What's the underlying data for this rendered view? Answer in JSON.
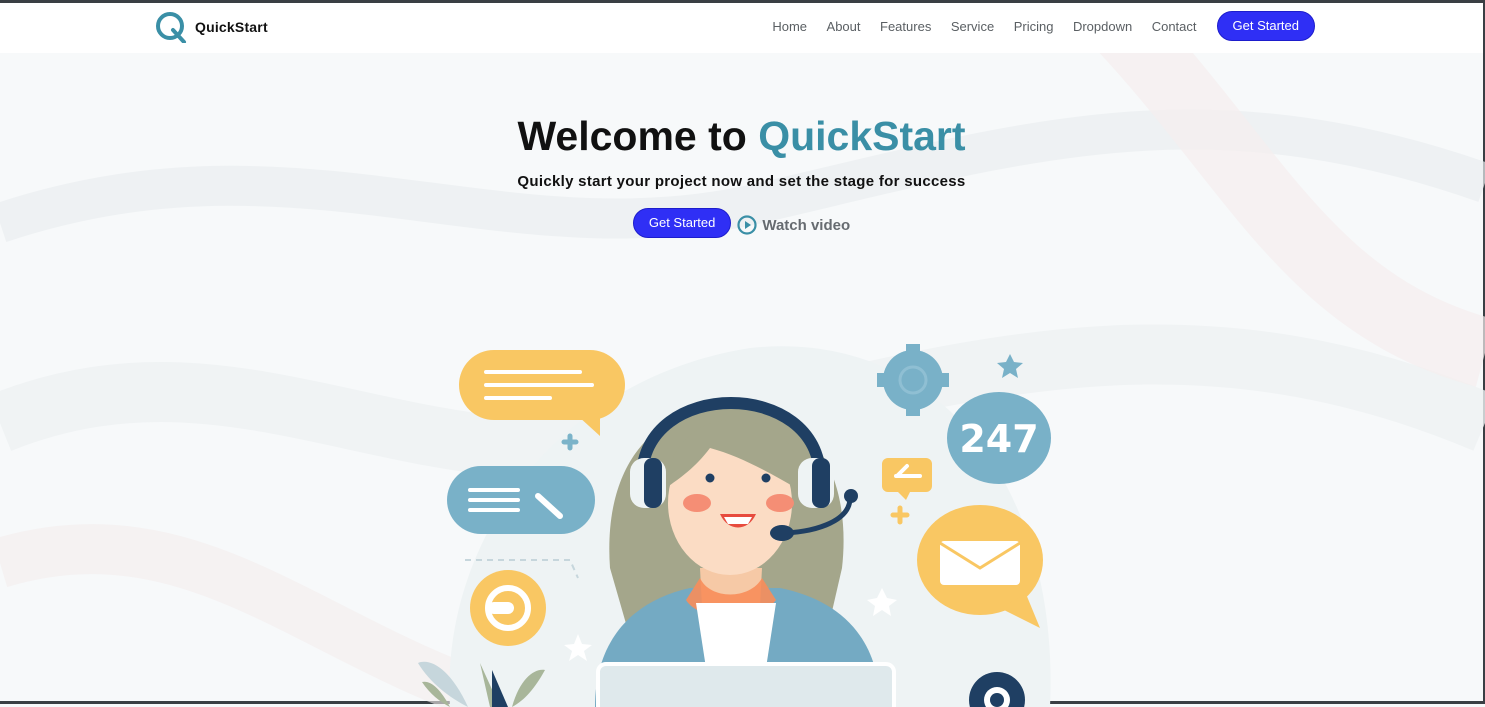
{
  "brand": {
    "name": "QuickStart",
    "logo_icon": "q-logo-icon",
    "accent": "#3a8fa6"
  },
  "nav": {
    "items": [
      "Home",
      "About",
      "Features",
      "Service",
      "Pricing",
      "Dropdown",
      "Contact"
    ],
    "cta_label": "Get Started"
  },
  "hero": {
    "title_prefix": "Welcome to",
    "title_accent": "QuickStart",
    "subtitle": "Quickly start your project now and set the stage for success",
    "cta_label": "Get Started",
    "watch_label": "Watch video"
  },
  "illustration": {
    "badge_text": "247"
  },
  "colors": {
    "primary_button": "#2f2ff5",
    "accent_text": "#3a8fa6"
  }
}
